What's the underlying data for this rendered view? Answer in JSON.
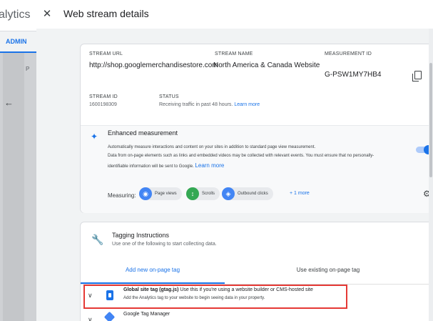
{
  "backdrop": {
    "app_title": "alytics",
    "admin_tab": "ADMIN",
    "panel_letter": "P",
    "back_icon": "arrow-left-icon"
  },
  "drawer": {
    "title": "Web stream details",
    "close_icon": "close-icon"
  },
  "stream": {
    "url_label": "STREAM URL",
    "url_value": "http://shop.googlemerchandisestore.com",
    "name_label": "STREAM NAME",
    "name_value": "North America & Canada Website",
    "mid_label": "MEASUREMENT ID",
    "mid_value": "G-PSW1MY7HB4",
    "id_label": "STREAM ID",
    "id_value": "1600198309",
    "status_label": "STATUS",
    "status_value": "Receiving traffic in past 48 hours.",
    "status_link": "Learn more"
  },
  "enhanced": {
    "title": "Enhanced measurement",
    "desc_line1": "Automatically measure interactions and content on your sites in addition to standard page view measurement.",
    "desc_line2": "Data from on-page elements such as links and embedded videos may be collected with relevant events. You must ensure that no personally-",
    "desc_line3": "identifiable information will be sent to Google.",
    "desc_link": "Learn more",
    "toggle_on": true,
    "measuring_label": "Measuring:",
    "chips": [
      {
        "label": "Page views",
        "icon": "eye-icon",
        "color": "#4285f4"
      },
      {
        "label": "Scrolls",
        "icon": "scroll-icon",
        "color": "#34a853"
      },
      {
        "label": "Outbound clicks",
        "icon": "click-icon",
        "color": "#4285f4"
      }
    ],
    "more_link": "+ 1 more"
  },
  "tagging": {
    "title": "Tagging Instructions",
    "subtitle": "Use one of the following to start collecting data.",
    "tabs": [
      "Add new on-page tag",
      "Use existing on-page tag"
    ],
    "rows": [
      {
        "title_bold": "Global site tag (gtag.js)",
        "title_rest": " Use this if you're using a website builder or CMS-hosted site",
        "desc": "Add the Analytics tag to your website to begin seeing data in your property."
      },
      {
        "title_bold": "Google Tag Manager",
        "title_rest": "",
        "desc": ""
      }
    ]
  },
  "colors": {
    "accent": "#1a73e8",
    "highlight": "#e53935"
  }
}
